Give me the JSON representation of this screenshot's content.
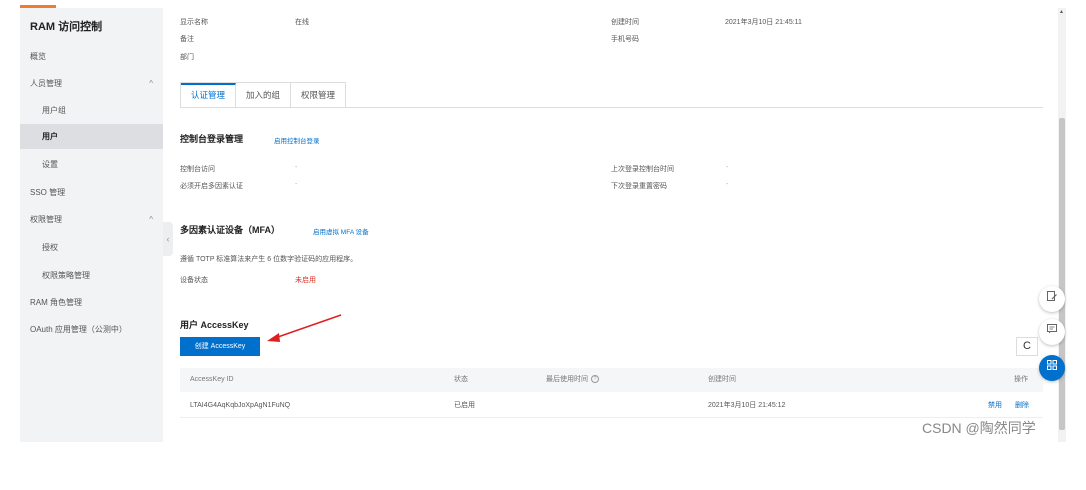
{
  "sidebar": {
    "title": "RAM 访问控制",
    "items": [
      {
        "label": "概览"
      },
      {
        "label": "人员管理",
        "chevron": "^"
      },
      {
        "label": "用户组"
      },
      {
        "label": "用户"
      },
      {
        "label": "设置"
      },
      {
        "label": "SSO 管理"
      },
      {
        "label": "权限管理",
        "chevron": "^"
      },
      {
        "label": "授权"
      },
      {
        "label": "权限策略管理"
      },
      {
        "label": "RAM 角色管理"
      },
      {
        "label": "OAuth 应用管理（公测中）"
      }
    ],
    "collapse_glyph": "‹"
  },
  "info": {
    "display_name_label": "显示名称",
    "display_name_value": "在线",
    "remark_label": "备注",
    "dept_label": "部门",
    "created_label": "创建时间",
    "created_value": "2021年3月10日 21:45:11",
    "phone_label": "手机号码"
  },
  "tabs": [
    "认证管理",
    "加入的组",
    "权限管理"
  ],
  "console_login": {
    "title": "控制台登录管理",
    "enable_link": "启用控制台登录",
    "access_label": "控制台访问",
    "access_value": "-",
    "mfa_required_label": "必须开启多因素认证",
    "mfa_required_value": "-",
    "last_login_label": "上次登录控制台时间",
    "last_login_value": "-",
    "reset_pwd_label": "下次登录重置密码",
    "reset_pwd_value": "-"
  },
  "mfa": {
    "title": "多因素认证设备（MFA）",
    "enable_link": "启用虚拟 MFA 设备",
    "desc": "遵循 TOTP 标准算法来产生 6 位数字验证码的应用程序。",
    "status_label": "设备状态",
    "status_value": "未启用"
  },
  "accesskey": {
    "title": "用户 AccessKey",
    "create_button": "创建 AccessKey",
    "refresh_glyph": "C",
    "columns": [
      "AccessKey ID",
      "状态",
      "最后使用时间",
      "创建时间",
      "操作"
    ],
    "info_glyph": "?",
    "rows": [
      {
        "id": "LTAI4G4AqKqbJoXpAgN1FuNQ",
        "status": "已启用",
        "last_used": "",
        "created": "2021年3月10日 21:45:12",
        "op_disable": "禁用",
        "op_delete": "删除"
      }
    ]
  },
  "float_icons": [
    "edit-icon",
    "chat-icon",
    "apps-icon"
  ],
  "scroll_glyph": "▲",
  "watermark": "CSDN @陶然同学",
  "colors": {
    "accent": "#0070cc",
    "brand": "#f07c30",
    "danger": "#d93026"
  }
}
